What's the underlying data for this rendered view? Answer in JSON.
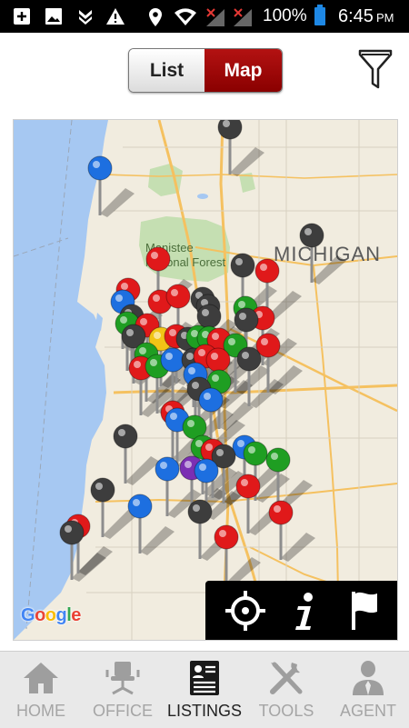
{
  "status_bar": {
    "battery_percent": "100%",
    "time": "6:45",
    "time_suffix": "PM",
    "icons": [
      "add-box-icon",
      "image-icon",
      "download-icon",
      "warning-icon",
      "location-icon",
      "wifi-icon",
      "no-signal-icon",
      "no-signal-icon",
      "battery-icon"
    ]
  },
  "header": {
    "toggle": {
      "list_label": "List",
      "map_label": "Map",
      "selected": "Map"
    },
    "filter_icon": "filter-icon"
  },
  "map": {
    "labels": {
      "state": "MICHIGAN",
      "forest_line1": "Manistee",
      "forest_line2": "National Forest"
    },
    "attribution": "Google",
    "pin_colors": {
      "red": "#e0191a",
      "blue": "#1d6fe0",
      "green": "#1f9e22",
      "black": "#3d3d3d",
      "yellow": "#f2c416",
      "purple": "#7b2fb3"
    },
    "toolbar": [
      {
        "name": "my-location-button",
        "icon": "crosshair-icon"
      },
      {
        "name": "info-button",
        "icon": "info-icon"
      },
      {
        "name": "flag-button",
        "icon": "flag-icon"
      }
    ]
  },
  "bottom_nav": {
    "items": [
      {
        "label": "HOME",
        "icon": "home-icon",
        "active": false
      },
      {
        "label": "OFFICE",
        "icon": "office-chair-icon",
        "active": false
      },
      {
        "label": "LISTINGS",
        "icon": "listings-icon",
        "active": true
      },
      {
        "label": "TOOLS",
        "icon": "tools-icon",
        "active": false
      },
      {
        "label": "AGENT",
        "icon": "agent-icon",
        "active": false
      }
    ]
  }
}
